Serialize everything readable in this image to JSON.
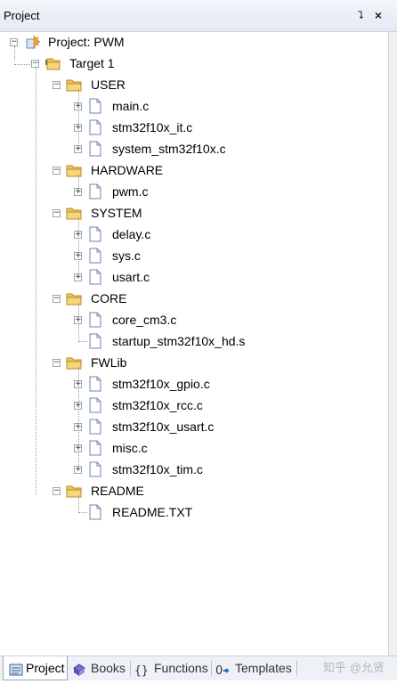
{
  "panel": {
    "title": "Project",
    "pin_glyph": "⮧",
    "close_glyph": "×"
  },
  "tree": {
    "project": "Project: PWM",
    "target": "Target 1",
    "groups": [
      {
        "name": "USER",
        "files": [
          "main.c",
          "stm32f10x_it.c",
          "system_stm32f10x.c"
        ]
      },
      {
        "name": "HARDWARE",
        "files": [
          "pwm.c"
        ]
      },
      {
        "name": "SYSTEM",
        "files": [
          "delay.c",
          "sys.c",
          "usart.c"
        ]
      },
      {
        "name": "CORE",
        "files": [
          "core_cm3.c",
          "startup_stm32f10x_hd.s"
        ]
      },
      {
        "name": "FWLib",
        "files": [
          "stm32f10x_gpio.c",
          "stm32f10x_rcc.c",
          "stm32f10x_usart.c",
          "misc.c",
          "stm32f10x_tim.c"
        ]
      },
      {
        "name": "README",
        "files": [
          "README.TXT"
        ]
      }
    ]
  },
  "tabs": [
    {
      "label": "Project",
      "icon": "project-icon",
      "active": true
    },
    {
      "label": "Books",
      "icon": "books-icon",
      "active": false
    },
    {
      "label": "Functions",
      "icon": "functions-icon",
      "active": false
    },
    {
      "label": "Templates",
      "icon": "templates-icon",
      "active": false
    }
  ],
  "watermark": "知乎 @允贤",
  "colors": {
    "folder": "#e8b64a",
    "titlebar": "#e3e9f3",
    "tab_bar": "#eef1f6"
  }
}
